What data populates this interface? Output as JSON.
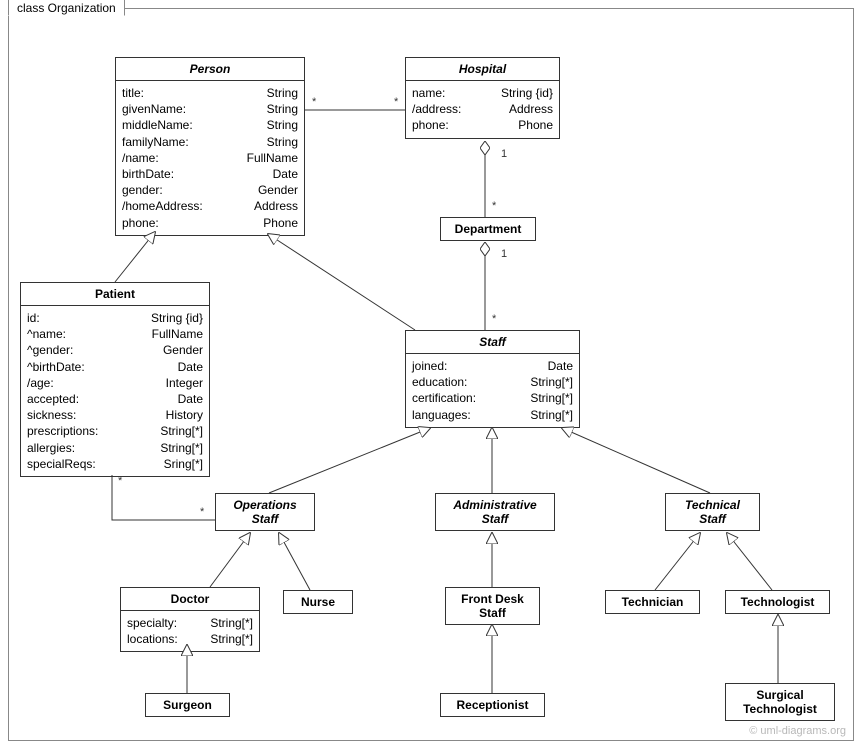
{
  "frame": {
    "label": "class Organization"
  },
  "watermark": "© uml-diagrams.org",
  "classes": {
    "person": {
      "name": "Person",
      "attrs": [
        {
          "n": "title:",
          "t": "String"
        },
        {
          "n": "givenName:",
          "t": "String"
        },
        {
          "n": "middleName:",
          "t": "String"
        },
        {
          "n": "familyName:",
          "t": "String"
        },
        {
          "n": "/name:",
          "t": "FullName"
        },
        {
          "n": "birthDate:",
          "t": "Date"
        },
        {
          "n": "gender:",
          "t": "Gender"
        },
        {
          "n": "/homeAddress:",
          "t": "Address"
        },
        {
          "n": "phone:",
          "t": "Phone"
        }
      ]
    },
    "hospital": {
      "name": "Hospital",
      "attrs": [
        {
          "n": "name:",
          "t": "String {id}"
        },
        {
          "n": "/address:",
          "t": "Address"
        },
        {
          "n": "phone:",
          "t": "Phone"
        }
      ]
    },
    "department": {
      "name": "Department"
    },
    "patient": {
      "name": "Patient",
      "attrs": [
        {
          "n": "id:",
          "t": "String {id}"
        },
        {
          "n": "^name:",
          "t": "FullName"
        },
        {
          "n": "^gender:",
          "t": "Gender"
        },
        {
          "n": "^birthDate:",
          "t": "Date"
        },
        {
          "n": "/age:",
          "t": "Integer"
        },
        {
          "n": "accepted:",
          "t": "Date"
        },
        {
          "n": "sickness:",
          "t": "History"
        },
        {
          "n": "prescriptions:",
          "t": "String[*]"
        },
        {
          "n": "allergies:",
          "t": "String[*]"
        },
        {
          "n": "specialReqs:",
          "t": "Sring[*]"
        }
      ]
    },
    "staff": {
      "name": "Staff",
      "attrs": [
        {
          "n": "joined:",
          "t": "Date"
        },
        {
          "n": "education:",
          "t": "String[*]"
        },
        {
          "n": "certification:",
          "t": "String[*]"
        },
        {
          "n": "languages:",
          "t": "String[*]"
        }
      ]
    },
    "opsStaff": {
      "name": "Operations",
      "sub": "Staff"
    },
    "adminStaff": {
      "name": "Administrative",
      "sub": "Staff"
    },
    "techStaff": {
      "name": "Technical",
      "sub": "Staff"
    },
    "doctor": {
      "name": "Doctor",
      "attrs": [
        {
          "n": "specialty:",
          "t": "String[*]"
        },
        {
          "n": "locations:",
          "t": "String[*]"
        }
      ]
    },
    "nurse": {
      "name": "Nurse"
    },
    "frontDesk": {
      "name": "Front Desk",
      "sub": "Staff"
    },
    "technician": {
      "name": "Technician"
    },
    "technologist": {
      "name": "Technologist"
    },
    "surgeon": {
      "name": "Surgeon"
    },
    "receptionist": {
      "name": "Receptionist"
    },
    "surgTech": {
      "name": "Surgical",
      "sub": "Technologist"
    }
  },
  "mult": {
    "star": "*",
    "one": "1"
  }
}
